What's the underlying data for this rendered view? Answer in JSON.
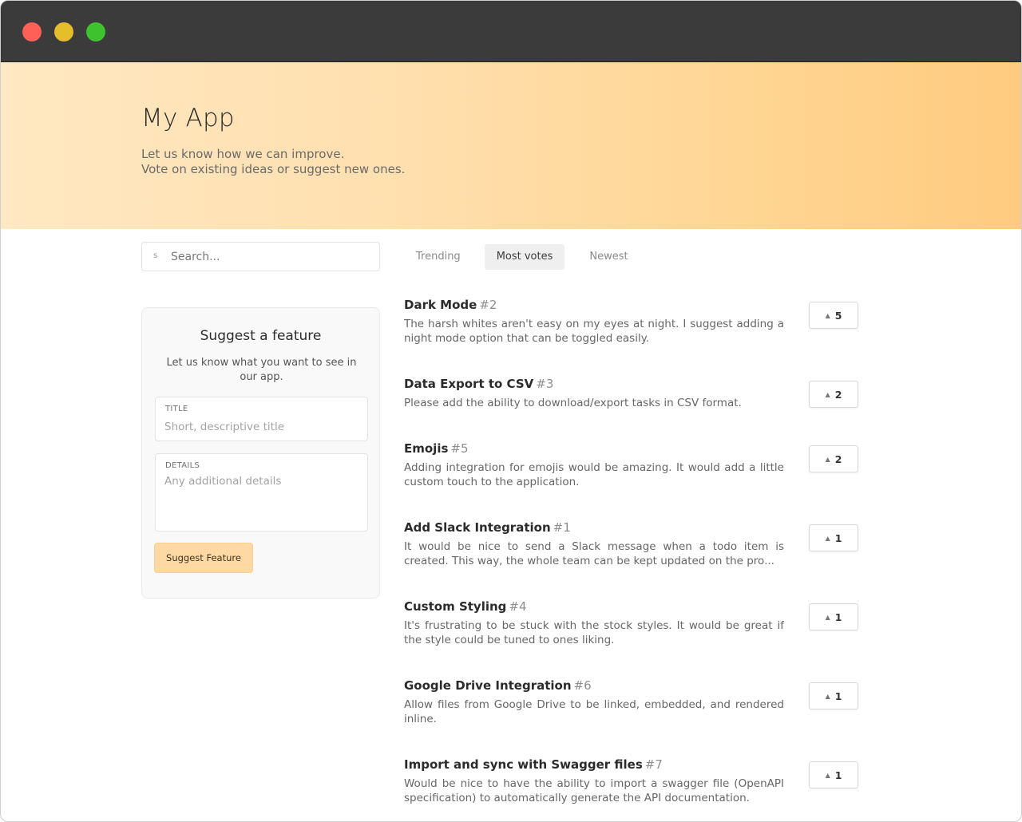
{
  "hero": {
    "title": "My App",
    "subtitle_line1": "Let us know how we can improve.",
    "subtitle_line2": "Vote on existing ideas or suggest new ones."
  },
  "search": {
    "icon_glyph": "s",
    "placeholder": "Search..."
  },
  "tabs": [
    {
      "label": "Trending",
      "active": false
    },
    {
      "label": "Most votes",
      "active": true
    },
    {
      "label": "Newest",
      "active": false
    }
  ],
  "suggest": {
    "title": "Suggest a feature",
    "description": "Let us know what you want to see in our app.",
    "title_label": "TITLE",
    "title_placeholder": "Short, descriptive title",
    "details_label": "DETAILS",
    "details_placeholder": "Any additional details",
    "button_label": "Suggest Feature"
  },
  "features": [
    {
      "title": "Dark Mode",
      "number": "#2",
      "description": "The harsh whites aren't easy on my eyes at night. I suggest adding a night mode option that can be toggled easily.",
      "votes": "5"
    },
    {
      "title": "Data Export to CSV",
      "number": "#3",
      "description": "Please add the ability to download/export tasks in CSV format.",
      "votes": "2"
    },
    {
      "title": "Emojis",
      "number": "#5",
      "description": "Adding integration for emojis would be amazing. It would add a little custom touch to the application.",
      "votes": "2"
    },
    {
      "title": "Add Slack Integration",
      "number": "#1",
      "description": "It would be nice to send a Slack message when a todo item is created. This way, the whole team can be kept updated on the pro...",
      "votes": "1"
    },
    {
      "title": "Custom Styling",
      "number": "#4",
      "description": "It's frustrating to be stuck with the stock styles. It would be great if the style could be tuned to ones liking.",
      "votes": "1"
    },
    {
      "title": "Google Drive Integration",
      "number": "#6",
      "description": "Allow files from Google Drive to be linked, embedded, and rendered inline.",
      "votes": "1"
    },
    {
      "title": "Import and sync with Swagger files",
      "number": "#7",
      "description": "Would be nice to have the ability to import a swagger file (OpenAPI specification) to automatically generate the API documentation.",
      "votes": "1"
    }
  ],
  "icons": {
    "upvote": "upvote-triangle-icon",
    "search": "search-icon"
  },
  "colors": {
    "hero_gradient_start": "#ffe8c2",
    "hero_gradient_end": "#ffcb80",
    "button_bg": "#ffd9a3",
    "titlebar": "#3b3b3b"
  }
}
